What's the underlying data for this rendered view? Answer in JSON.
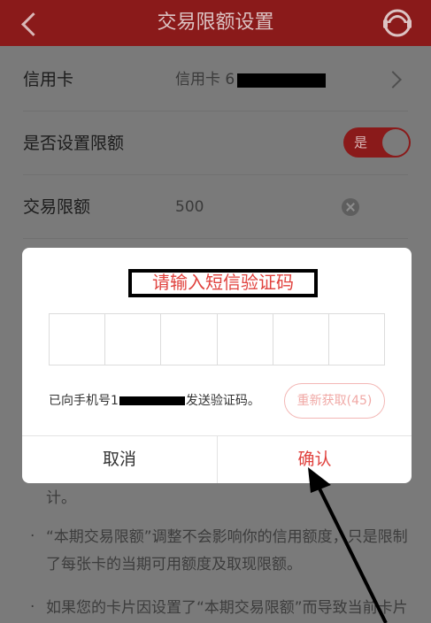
{
  "header": {
    "title": "交易限额设置"
  },
  "rows": {
    "card": {
      "label": "信用卡",
      "value": "信用卡 6"
    },
    "set_limit": {
      "label": "是否设置限额",
      "toggle_label": "是"
    },
    "limit": {
      "label": "交易限额",
      "value": "500"
    }
  },
  "background_text": {
    "line1_tail": "计。",
    "bullet1_line1": "“本期交易限额”调整不会影响你的信用额度，只是限制",
    "bullet1_line2": "了每张卡的当期可用额度及取现限额。",
    "bullet2_line1": "如果您的卡片因设置了“本期交易限额”而导致当前卡片"
  },
  "dialog": {
    "title": "请输入短信验证码",
    "sms_hint_pre": "已向手机号1",
    "sms_hint_post": "发送验证码。",
    "resend_label": "重新获取(45)",
    "cancel_label": "取消",
    "confirm_label": "确认",
    "code_box_count": 6
  },
  "colors": {
    "brand_red": "#e0423e",
    "header_bg_dimmed": "#8a1a1a",
    "overlay_bg": "#7a7a7a"
  }
}
